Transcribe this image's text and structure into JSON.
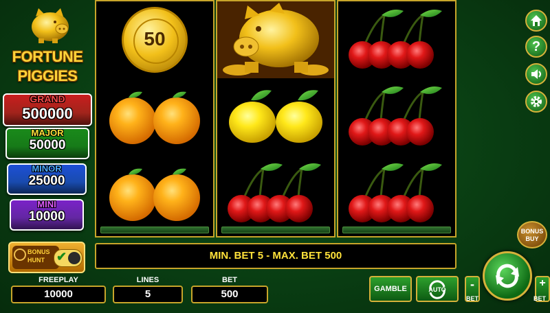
{
  "logo": {
    "line1": "FORTUNE",
    "line2": "PIGGIES"
  },
  "jackpots": [
    {
      "label": "GRAND",
      "value": "500000",
      "color": "#c81e1e",
      "label_color": "#ff4a4a"
    },
    {
      "label": "MAJOR",
      "value": "50000",
      "color": "#1a8a1a",
      "label_color": "#ffe23a"
    },
    {
      "label": "MINOR",
      "value": "25000",
      "color": "#1d4fd6",
      "label_color": "#4aa8ff"
    },
    {
      "label": "MINI",
      "value": "10000",
      "color": "#7a22c8",
      "label_color": "#e05aff"
    }
  ],
  "bonus_hunt": {
    "line1": "BONUS",
    "line2": "HUNT"
  },
  "coin_value": "50",
  "message": "MIN. BET 5 - MAX. BET 500",
  "fields": {
    "freeplay_label": "FREEPLAY",
    "freeplay": "10000",
    "lines_label": "LINES",
    "lines": "5",
    "bet_label": "BET",
    "bet": "500"
  },
  "buttons": {
    "gamble": "GAMBLE",
    "auto": "AUTO",
    "bet_minus": "-",
    "bet_minus_label": "BET",
    "bet_plus": "+",
    "bet_plus_label": "BET",
    "bonus_buy_line1": "BONUS",
    "bonus_buy_line2": "BUY"
  },
  "side_icons": [
    "home-icon",
    "help-icon",
    "sound-icon",
    "settings-icon"
  ],
  "reels": [
    [
      "coin",
      "orange",
      "orange"
    ],
    [
      "piggy",
      "lemon",
      "cherry"
    ],
    [
      "cherry",
      "cherry",
      "cherry"
    ]
  ]
}
